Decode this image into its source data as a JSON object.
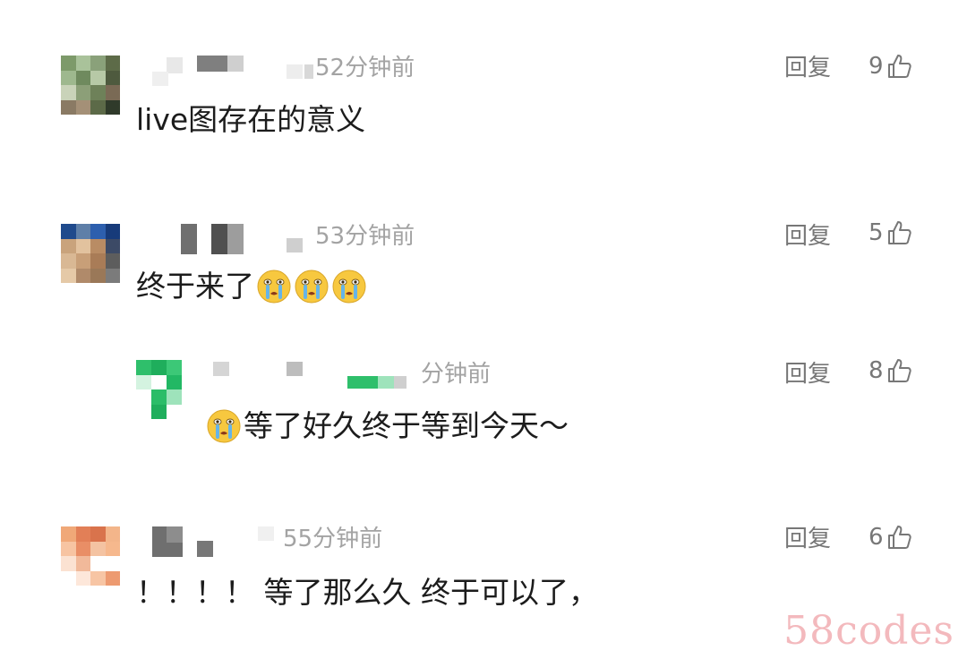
{
  "comments": [
    {
      "time": "52分钟前",
      "text": "live图存在的意义",
      "reply_label": "回复",
      "likes": "9"
    },
    {
      "time": "53分钟前",
      "text": "终于来了",
      "emoji": "loudly-crying-face",
      "emoji_count": 3,
      "reply_label": "回复",
      "likes": "5"
    },
    {
      "time": "分钟前",
      "text": "等了好久终于等到今天～",
      "emoji": "loudly-crying-face",
      "reply_label": "回复",
      "likes": "8"
    },
    {
      "time": "55分钟前",
      "text": "！！！！ 等了那么久 终于可以了，",
      "reply_label": "回复",
      "likes": "6"
    }
  ],
  "watermark": "58codes",
  "colors": {
    "time_text": "#a3a3a3",
    "reply_text": "#777777",
    "comment_text": "#1c1c1c",
    "watermark": "#f3b9bd",
    "emoji_face": "#f7c83f",
    "emoji_tears": "#66b4e8"
  }
}
